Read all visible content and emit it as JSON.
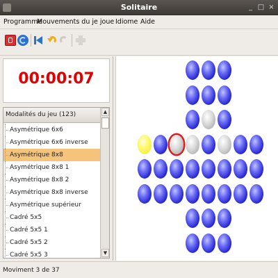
{
  "window": {
    "title": "Solitaire",
    "controls": [
      "_",
      "□",
      "×"
    ]
  },
  "menu": [
    {
      "label": "Programme",
      "accel": "P"
    },
    {
      "label": "Mouvements du je joue",
      "accel": "M"
    },
    {
      "label": "Idiome",
      "accel": "I"
    },
    {
      "label": "Aide",
      "accel": "A"
    }
  ],
  "toolbar": {
    "buttons": [
      {
        "icon": "quit-icon",
        "color": "#d83030"
      },
      {
        "icon": "new-game-icon",
        "color": "#2f6fd0"
      },
      {
        "icon": "undo-first-icon",
        "color": "#2f73c8"
      },
      {
        "icon": "undo-icon",
        "color": "#e8b020"
      },
      {
        "icon": "redo-icon",
        "color": "#cfcac3"
      },
      {
        "icon": "hint-icon",
        "color": "#d8d4ce"
      }
    ]
  },
  "timer": "00:00:07",
  "game_list": {
    "header": "Modalités du jeu (123)",
    "items": [
      "Asymétrique 6x6",
      "Asymétrique 6x6 inverse",
      "Asymétrique 8x8",
      "Asymétrique 8x8 1",
      "Asymétrique 8x8 2",
      "Asymétrique 8x8 inverse",
      "Asymétrique supérieur",
      "Cadré 5x5",
      "Cadré 5x5 1",
      "Cadré 5x5 2",
      "Cadré 5x5 3"
    ],
    "selected": "Asymétrique 8x8"
  },
  "board": {
    "selected_peg": "row 4, column 3",
    "rows": [
      "...BBB..",
      "...BBB..",
      "...BEB..",
      "YBSEBEBB",
      "BBBBBBBB",
      "BBBBBBBB",
      "...BBB..",
      "...BBB.."
    ],
    "legend": {
      "B": "blue peg",
      "E": "empty hole",
      "Y": "yellow peg",
      "S": "selected peg"
    },
    "colors": {
      "peg": "#1e1ed0",
      "hole": "#d8d8d8",
      "marked": "#fff870",
      "selection": "#e01818"
    }
  },
  "status": "Moviment 3 de 37"
}
